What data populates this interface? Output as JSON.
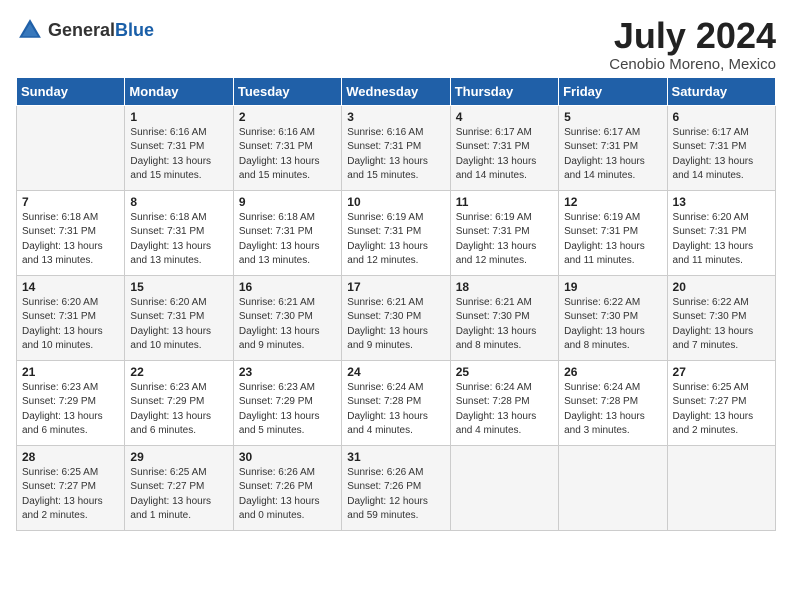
{
  "logo": {
    "general": "General",
    "blue": "Blue"
  },
  "title": "July 2024",
  "location": "Cenobio Moreno, Mexico",
  "days_of_week": [
    "Sunday",
    "Monday",
    "Tuesday",
    "Wednesday",
    "Thursday",
    "Friday",
    "Saturday"
  ],
  "weeks": [
    [
      {
        "day": "",
        "info": ""
      },
      {
        "day": "1",
        "info": "Sunrise: 6:16 AM\nSunset: 7:31 PM\nDaylight: 13 hours\nand 15 minutes."
      },
      {
        "day": "2",
        "info": "Sunrise: 6:16 AM\nSunset: 7:31 PM\nDaylight: 13 hours\nand 15 minutes."
      },
      {
        "day": "3",
        "info": "Sunrise: 6:16 AM\nSunset: 7:31 PM\nDaylight: 13 hours\nand 15 minutes."
      },
      {
        "day": "4",
        "info": "Sunrise: 6:17 AM\nSunset: 7:31 PM\nDaylight: 13 hours\nand 14 minutes."
      },
      {
        "day": "5",
        "info": "Sunrise: 6:17 AM\nSunset: 7:31 PM\nDaylight: 13 hours\nand 14 minutes."
      },
      {
        "day": "6",
        "info": "Sunrise: 6:17 AM\nSunset: 7:31 PM\nDaylight: 13 hours\nand 14 minutes."
      }
    ],
    [
      {
        "day": "7",
        "info": "Sunrise: 6:18 AM\nSunset: 7:31 PM\nDaylight: 13 hours\nand 13 minutes."
      },
      {
        "day": "8",
        "info": "Sunrise: 6:18 AM\nSunset: 7:31 PM\nDaylight: 13 hours\nand 13 minutes."
      },
      {
        "day": "9",
        "info": "Sunrise: 6:18 AM\nSunset: 7:31 PM\nDaylight: 13 hours\nand 13 minutes."
      },
      {
        "day": "10",
        "info": "Sunrise: 6:19 AM\nSunset: 7:31 PM\nDaylight: 13 hours\nand 12 minutes."
      },
      {
        "day": "11",
        "info": "Sunrise: 6:19 AM\nSunset: 7:31 PM\nDaylight: 13 hours\nand 12 minutes."
      },
      {
        "day": "12",
        "info": "Sunrise: 6:19 AM\nSunset: 7:31 PM\nDaylight: 13 hours\nand 11 minutes."
      },
      {
        "day": "13",
        "info": "Sunrise: 6:20 AM\nSunset: 7:31 PM\nDaylight: 13 hours\nand 11 minutes."
      }
    ],
    [
      {
        "day": "14",
        "info": "Sunrise: 6:20 AM\nSunset: 7:31 PM\nDaylight: 13 hours\nand 10 minutes."
      },
      {
        "day": "15",
        "info": "Sunrise: 6:20 AM\nSunset: 7:31 PM\nDaylight: 13 hours\nand 10 minutes."
      },
      {
        "day": "16",
        "info": "Sunrise: 6:21 AM\nSunset: 7:30 PM\nDaylight: 13 hours\nand 9 minutes."
      },
      {
        "day": "17",
        "info": "Sunrise: 6:21 AM\nSunset: 7:30 PM\nDaylight: 13 hours\nand 9 minutes."
      },
      {
        "day": "18",
        "info": "Sunrise: 6:21 AM\nSunset: 7:30 PM\nDaylight: 13 hours\nand 8 minutes."
      },
      {
        "day": "19",
        "info": "Sunrise: 6:22 AM\nSunset: 7:30 PM\nDaylight: 13 hours\nand 8 minutes."
      },
      {
        "day": "20",
        "info": "Sunrise: 6:22 AM\nSunset: 7:30 PM\nDaylight: 13 hours\nand 7 minutes."
      }
    ],
    [
      {
        "day": "21",
        "info": "Sunrise: 6:23 AM\nSunset: 7:29 PM\nDaylight: 13 hours\nand 6 minutes."
      },
      {
        "day": "22",
        "info": "Sunrise: 6:23 AM\nSunset: 7:29 PM\nDaylight: 13 hours\nand 6 minutes."
      },
      {
        "day": "23",
        "info": "Sunrise: 6:23 AM\nSunset: 7:29 PM\nDaylight: 13 hours\nand 5 minutes."
      },
      {
        "day": "24",
        "info": "Sunrise: 6:24 AM\nSunset: 7:28 PM\nDaylight: 13 hours\nand 4 minutes."
      },
      {
        "day": "25",
        "info": "Sunrise: 6:24 AM\nSunset: 7:28 PM\nDaylight: 13 hours\nand 4 minutes."
      },
      {
        "day": "26",
        "info": "Sunrise: 6:24 AM\nSunset: 7:28 PM\nDaylight: 13 hours\nand 3 minutes."
      },
      {
        "day": "27",
        "info": "Sunrise: 6:25 AM\nSunset: 7:27 PM\nDaylight: 13 hours\nand 2 minutes."
      }
    ],
    [
      {
        "day": "28",
        "info": "Sunrise: 6:25 AM\nSunset: 7:27 PM\nDaylight: 13 hours\nand 2 minutes."
      },
      {
        "day": "29",
        "info": "Sunrise: 6:25 AM\nSunset: 7:27 PM\nDaylight: 13 hours\nand 1 minute."
      },
      {
        "day": "30",
        "info": "Sunrise: 6:26 AM\nSunset: 7:26 PM\nDaylight: 13 hours\nand 0 minutes."
      },
      {
        "day": "31",
        "info": "Sunrise: 6:26 AM\nSunset: 7:26 PM\nDaylight: 12 hours\nand 59 minutes."
      },
      {
        "day": "",
        "info": ""
      },
      {
        "day": "",
        "info": ""
      },
      {
        "day": "",
        "info": ""
      }
    ]
  ]
}
